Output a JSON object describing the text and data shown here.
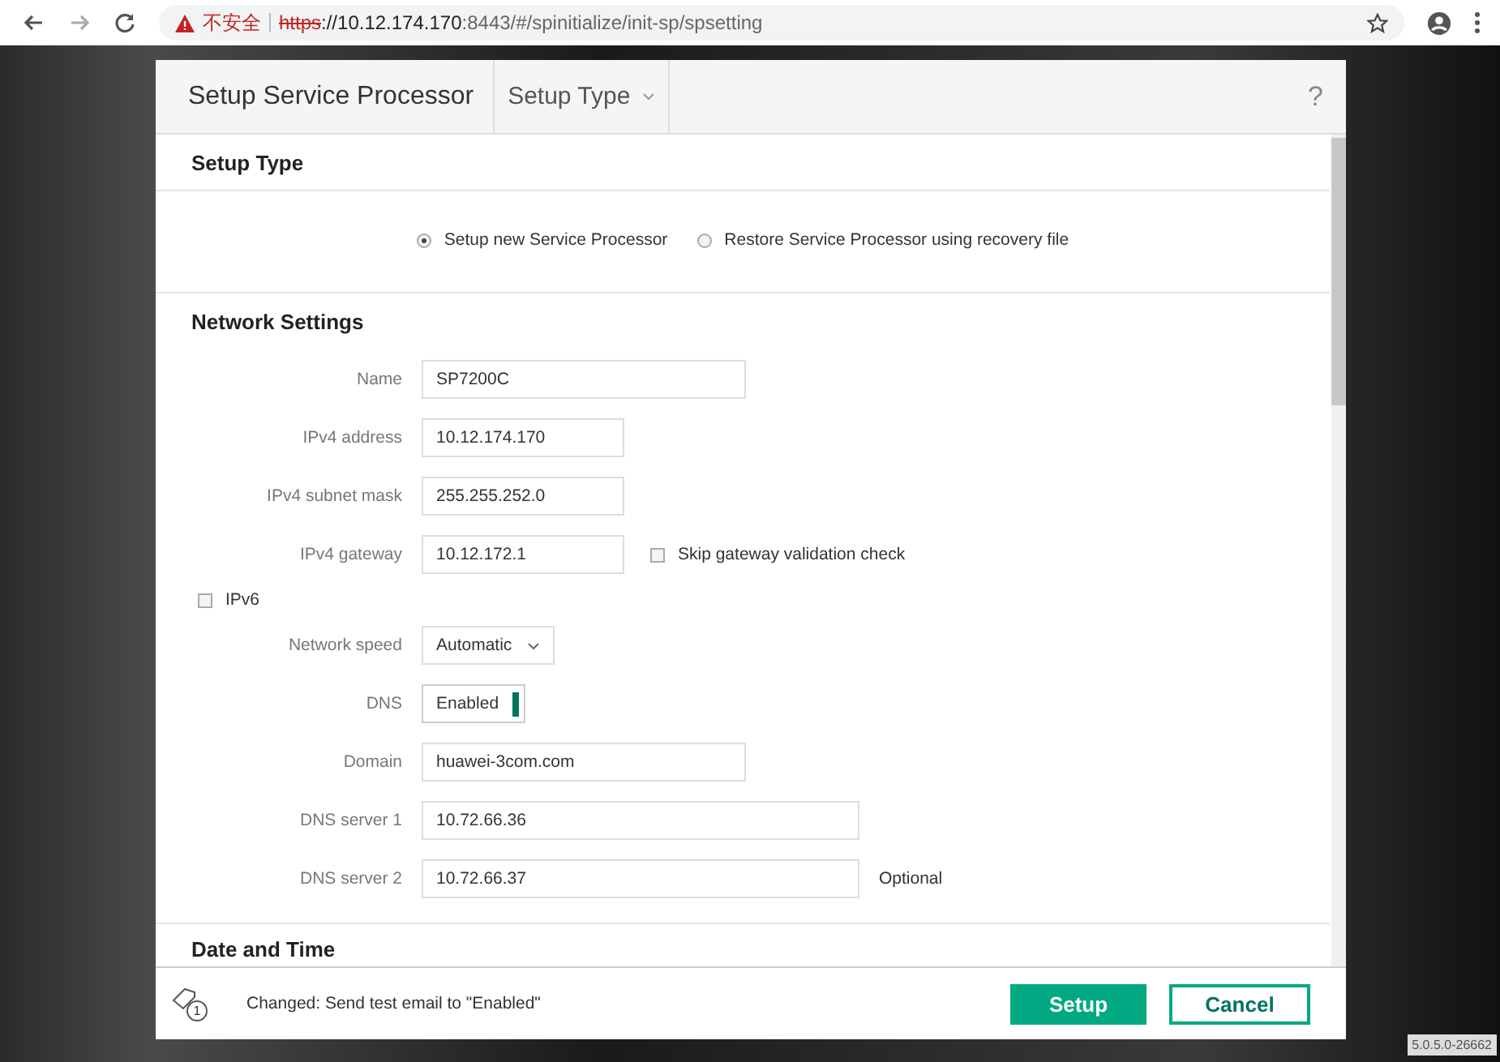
{
  "browser": {
    "security_label": "不安全",
    "url_scheme": "https",
    "url_host": "://10.12.174.170",
    "url_rest": ":8443/#/spinitialize/init-sp/spsetting"
  },
  "dialog": {
    "title": "Setup Service Processor",
    "menu": "Setup Type",
    "help": "?"
  },
  "setup_type": {
    "heading": "Setup Type",
    "options": [
      {
        "label": "Setup new Service Processor",
        "selected": true
      },
      {
        "label": "Restore Service Processor using recovery file",
        "selected": false
      }
    ]
  },
  "network": {
    "heading": "Network Settings",
    "rows": [
      {
        "kind": "text",
        "label": "Name",
        "value": "SP7200C"
      },
      {
        "kind": "text",
        "label": "IPv4 address",
        "value": "10.12.174.170"
      },
      {
        "kind": "text",
        "label": "IPv4 subnet mask",
        "value": "255.255.252.0"
      },
      {
        "kind": "text",
        "label": "IPv4 gateway",
        "value": "10.12.172.1",
        "check": {
          "label": "Skip gateway validation check",
          "checked": false
        }
      },
      {
        "kind": "checkbox",
        "label": "IPv6",
        "checked": false
      },
      {
        "kind": "select",
        "label": "Network speed",
        "value": "Automatic"
      },
      {
        "kind": "toggle",
        "label": "DNS",
        "value": "Enabled",
        "on": true
      },
      {
        "kind": "text",
        "label": "Domain",
        "value": "huawei-3com.com"
      },
      {
        "kind": "text",
        "label": "DNS server 1",
        "value": "10.72.66.36"
      },
      {
        "kind": "text",
        "label": "DNS server 2",
        "value": "10.72.66.37",
        "note": "Optional"
      }
    ]
  },
  "next_section": {
    "heading": "Date and Time"
  },
  "footer": {
    "change_count": "1",
    "message": "Changed: Send test email to \"Enabled\"",
    "buttons": [
      {
        "label": "Setup",
        "kind": "primary"
      },
      {
        "label": "Cancel",
        "kind": "secondary"
      }
    ]
  },
  "version": "5.0.5.0-26662"
}
